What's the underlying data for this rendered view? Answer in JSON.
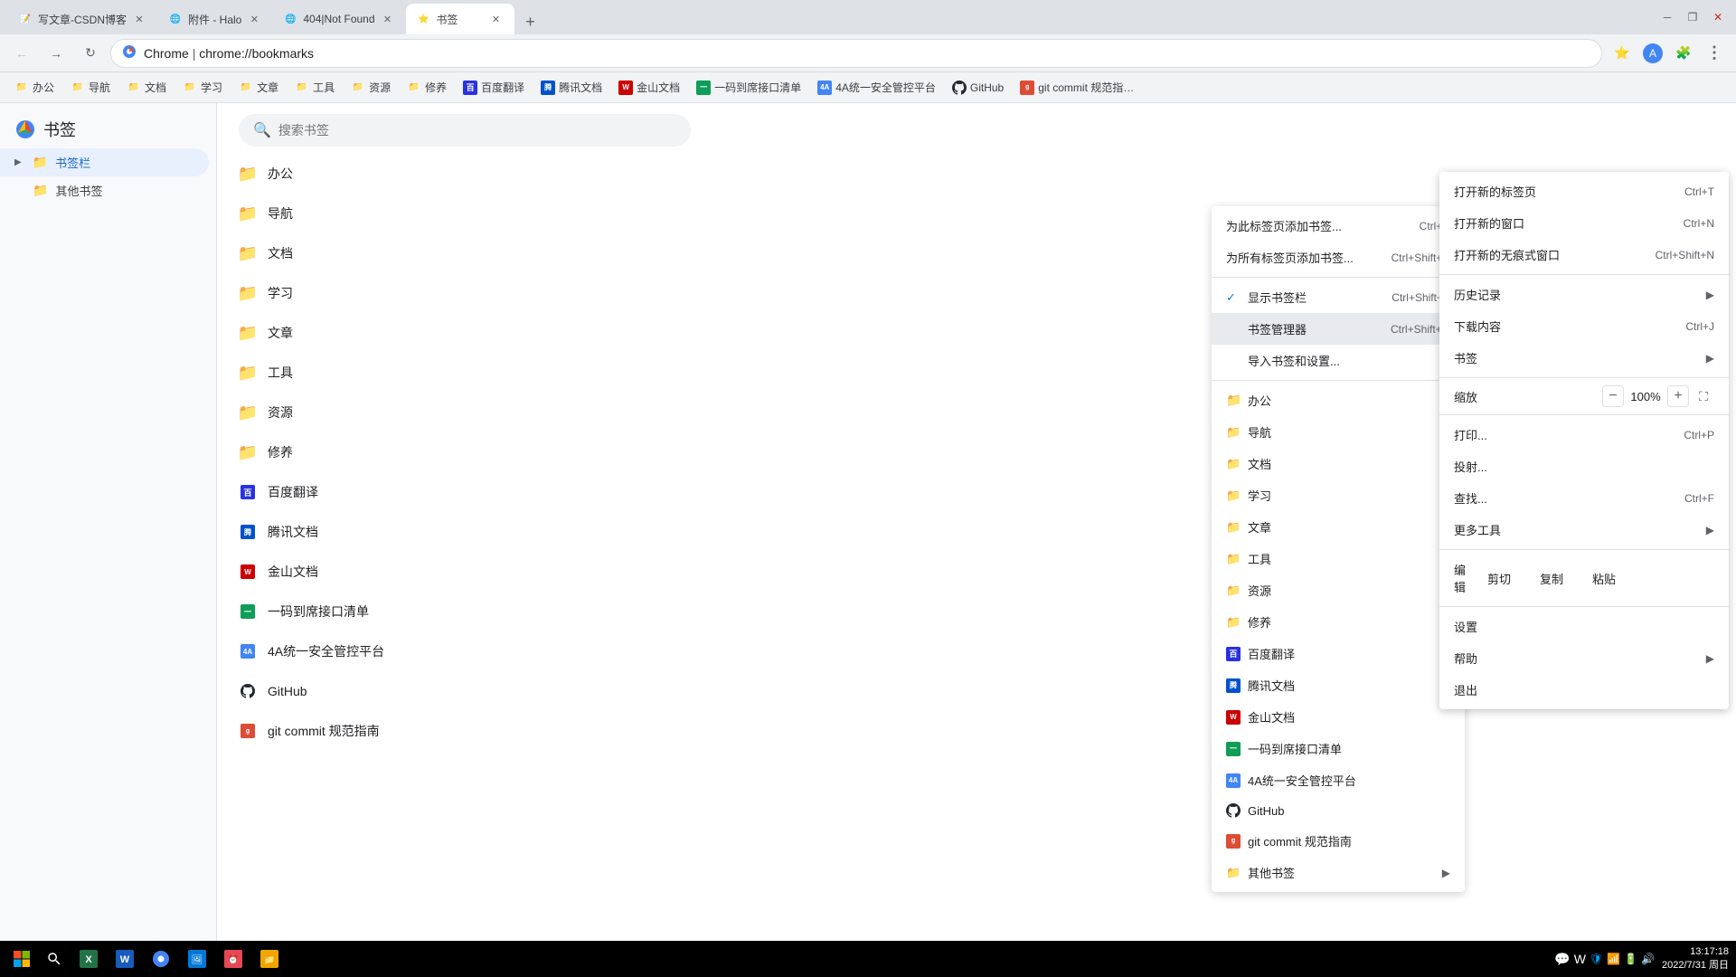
{
  "browser": {
    "tabs": [
      {
        "id": "tab1",
        "title": "写文章-CSDN博客",
        "active": false,
        "favicon": "📝"
      },
      {
        "id": "tab2",
        "title": "附件 - Halo",
        "active": false,
        "favicon": "🌐"
      },
      {
        "id": "tab3",
        "title": "404|Not Found",
        "active": false,
        "favicon": "🌐"
      },
      {
        "id": "tab4",
        "title": "书签",
        "active": true,
        "favicon": "⭐"
      }
    ],
    "new_tab_label": "+",
    "address": {
      "protocol": "Chrome",
      "url": "chrome://bookmarks",
      "display": "Chrome  |  chrome://bookmarks"
    }
  },
  "toolbar_actions": {
    "bookmark_label": "⭐",
    "extensions_label": "🧩",
    "account_label": "👤"
  },
  "bookmarks_bar": {
    "items": [
      {
        "name": "办公",
        "icon": "folder"
      },
      {
        "name": "导航",
        "icon": "folder"
      },
      {
        "name": "文档",
        "icon": "folder"
      },
      {
        "name": "学习",
        "icon": "folder"
      },
      {
        "name": "文章",
        "icon": "folder"
      },
      {
        "name": "工具",
        "icon": "folder"
      },
      {
        "name": "资源",
        "icon": "folder"
      },
      {
        "name": "修养",
        "icon": "folder"
      },
      {
        "name": "百度翻译",
        "icon": "baidu"
      },
      {
        "name": "腾讯文档",
        "icon": "tencent"
      },
      {
        "name": "金山文档",
        "icon": "wps"
      },
      {
        "name": "一码到席接口清单",
        "icon": "green"
      },
      {
        "name": "4A统一安全管控平台",
        "icon": "blue4a"
      },
      {
        "name": "GitHub",
        "icon": "github"
      },
      {
        "name": "git commit 规范指…",
        "icon": "git"
      }
    ]
  },
  "page": {
    "title": "书签",
    "search_placeholder": "搜索书签"
  },
  "sidebar": {
    "items": [
      {
        "name": "书签栏",
        "active": true,
        "expanded": true
      },
      {
        "name": "其他书签",
        "active": false
      }
    ]
  },
  "bookmark_list": {
    "items": [
      {
        "name": "办公",
        "type": "folder"
      },
      {
        "name": "导航",
        "type": "folder"
      },
      {
        "name": "文档",
        "type": "folder"
      },
      {
        "name": "学习",
        "type": "folder"
      },
      {
        "name": "文章",
        "type": "folder"
      },
      {
        "name": "工具",
        "type": "folder"
      },
      {
        "name": "资源",
        "type": "folder"
      },
      {
        "name": "修养",
        "type": "folder"
      },
      {
        "name": "百度翻译",
        "type": "link",
        "icon": "baidu"
      },
      {
        "name": "腾讯文档",
        "type": "link",
        "icon": "tencent"
      },
      {
        "name": "金山文档",
        "type": "link",
        "icon": "wps"
      },
      {
        "name": "一码到席接口清单",
        "type": "link",
        "icon": "green"
      },
      {
        "name": "4A统一安全管控平台",
        "type": "link",
        "icon": "blue4a"
      },
      {
        "name": "GitHub",
        "type": "link",
        "icon": "github"
      },
      {
        "name": "git commit 规范指南",
        "type": "link",
        "icon": "git"
      }
    ]
  },
  "bookmarks_dropdown": {
    "items": [
      {
        "label": "为此标签页添加书签...",
        "shortcut": "Ctrl+D",
        "type": "action"
      },
      {
        "label": "为所有标签页添加书签...",
        "shortcut": "Ctrl+Shift+D",
        "type": "action"
      },
      {
        "label": "显示书签栏",
        "shortcut": "Ctrl+Shift+B",
        "type": "check",
        "checked": true
      },
      {
        "label": "书签管理器",
        "shortcut": "Ctrl+Shift+O",
        "type": "action",
        "highlighted": true
      },
      {
        "label": "导入书签和设置...",
        "type": "action"
      }
    ],
    "folders": [
      {
        "name": "办公",
        "icon": "folder",
        "has_sub": true
      },
      {
        "name": "导航",
        "icon": "folder",
        "has_sub": true
      },
      {
        "name": "文档",
        "icon": "folder",
        "has_sub": true
      },
      {
        "name": "学习",
        "icon": "folder",
        "has_sub": true
      },
      {
        "name": "文章",
        "icon": "folder",
        "has_sub": true
      },
      {
        "name": "工具",
        "icon": "folder",
        "has_sub": true
      },
      {
        "name": "资源",
        "icon": "folder",
        "has_sub": true
      },
      {
        "name": "修养",
        "icon": "folder",
        "has_sub": true
      },
      {
        "name": "百度翻译",
        "icon": "baidu",
        "has_sub": false
      },
      {
        "name": "腾讯文档",
        "icon": "tencent",
        "has_sub": false
      },
      {
        "name": "金山文档",
        "icon": "wps",
        "has_sub": false
      },
      {
        "name": "一码到席接口清单",
        "icon": "green",
        "has_sub": false
      },
      {
        "name": "4A统一安全管控平台",
        "icon": "blue4a",
        "has_sub": false
      },
      {
        "name": "GitHub",
        "icon": "github",
        "has_sub": false
      },
      {
        "name": "git commit 规范指南",
        "icon": "git",
        "has_sub": false
      },
      {
        "name": "其他书签",
        "icon": "folder",
        "has_sub": true
      }
    ],
    "section_label": "书签"
  },
  "chrome_menu": {
    "items": [
      {
        "label": "打开新的标签页",
        "shortcut": "Ctrl+T",
        "type": "action"
      },
      {
        "label": "打开新的窗口",
        "shortcut": "Ctrl+N",
        "type": "action"
      },
      {
        "label": "打开新的无痕式窗口",
        "shortcut": "Ctrl+Shift+N",
        "type": "action"
      },
      {
        "type": "divider"
      },
      {
        "label": "历史记录",
        "type": "submenu"
      },
      {
        "label": "下载内容",
        "shortcut": "Ctrl+J",
        "type": "submenu"
      },
      {
        "label": "书签",
        "type": "submenu"
      },
      {
        "type": "divider"
      },
      {
        "label": "缩放",
        "type": "zoom"
      },
      {
        "type": "divider"
      },
      {
        "label": "打印...",
        "shortcut": "Ctrl+P",
        "type": "action"
      },
      {
        "label": "投射...",
        "type": "action"
      },
      {
        "label": "查找...",
        "shortcut": "Ctrl+F",
        "type": "action"
      },
      {
        "label": "更多工具",
        "type": "submenu"
      },
      {
        "type": "divider"
      },
      {
        "label": "编辑",
        "type": "edit_row",
        "buttons": [
          "剪切",
          "复制",
          "粘贴"
        ]
      },
      {
        "type": "divider"
      },
      {
        "label": "设置",
        "type": "action"
      },
      {
        "label": "帮助",
        "type": "submenu"
      },
      {
        "label": "退出",
        "type": "action"
      }
    ],
    "zoom_value": "100%"
  },
  "taskbar": {
    "time": "13:17:18",
    "date": "2022/7/31 周日"
  }
}
